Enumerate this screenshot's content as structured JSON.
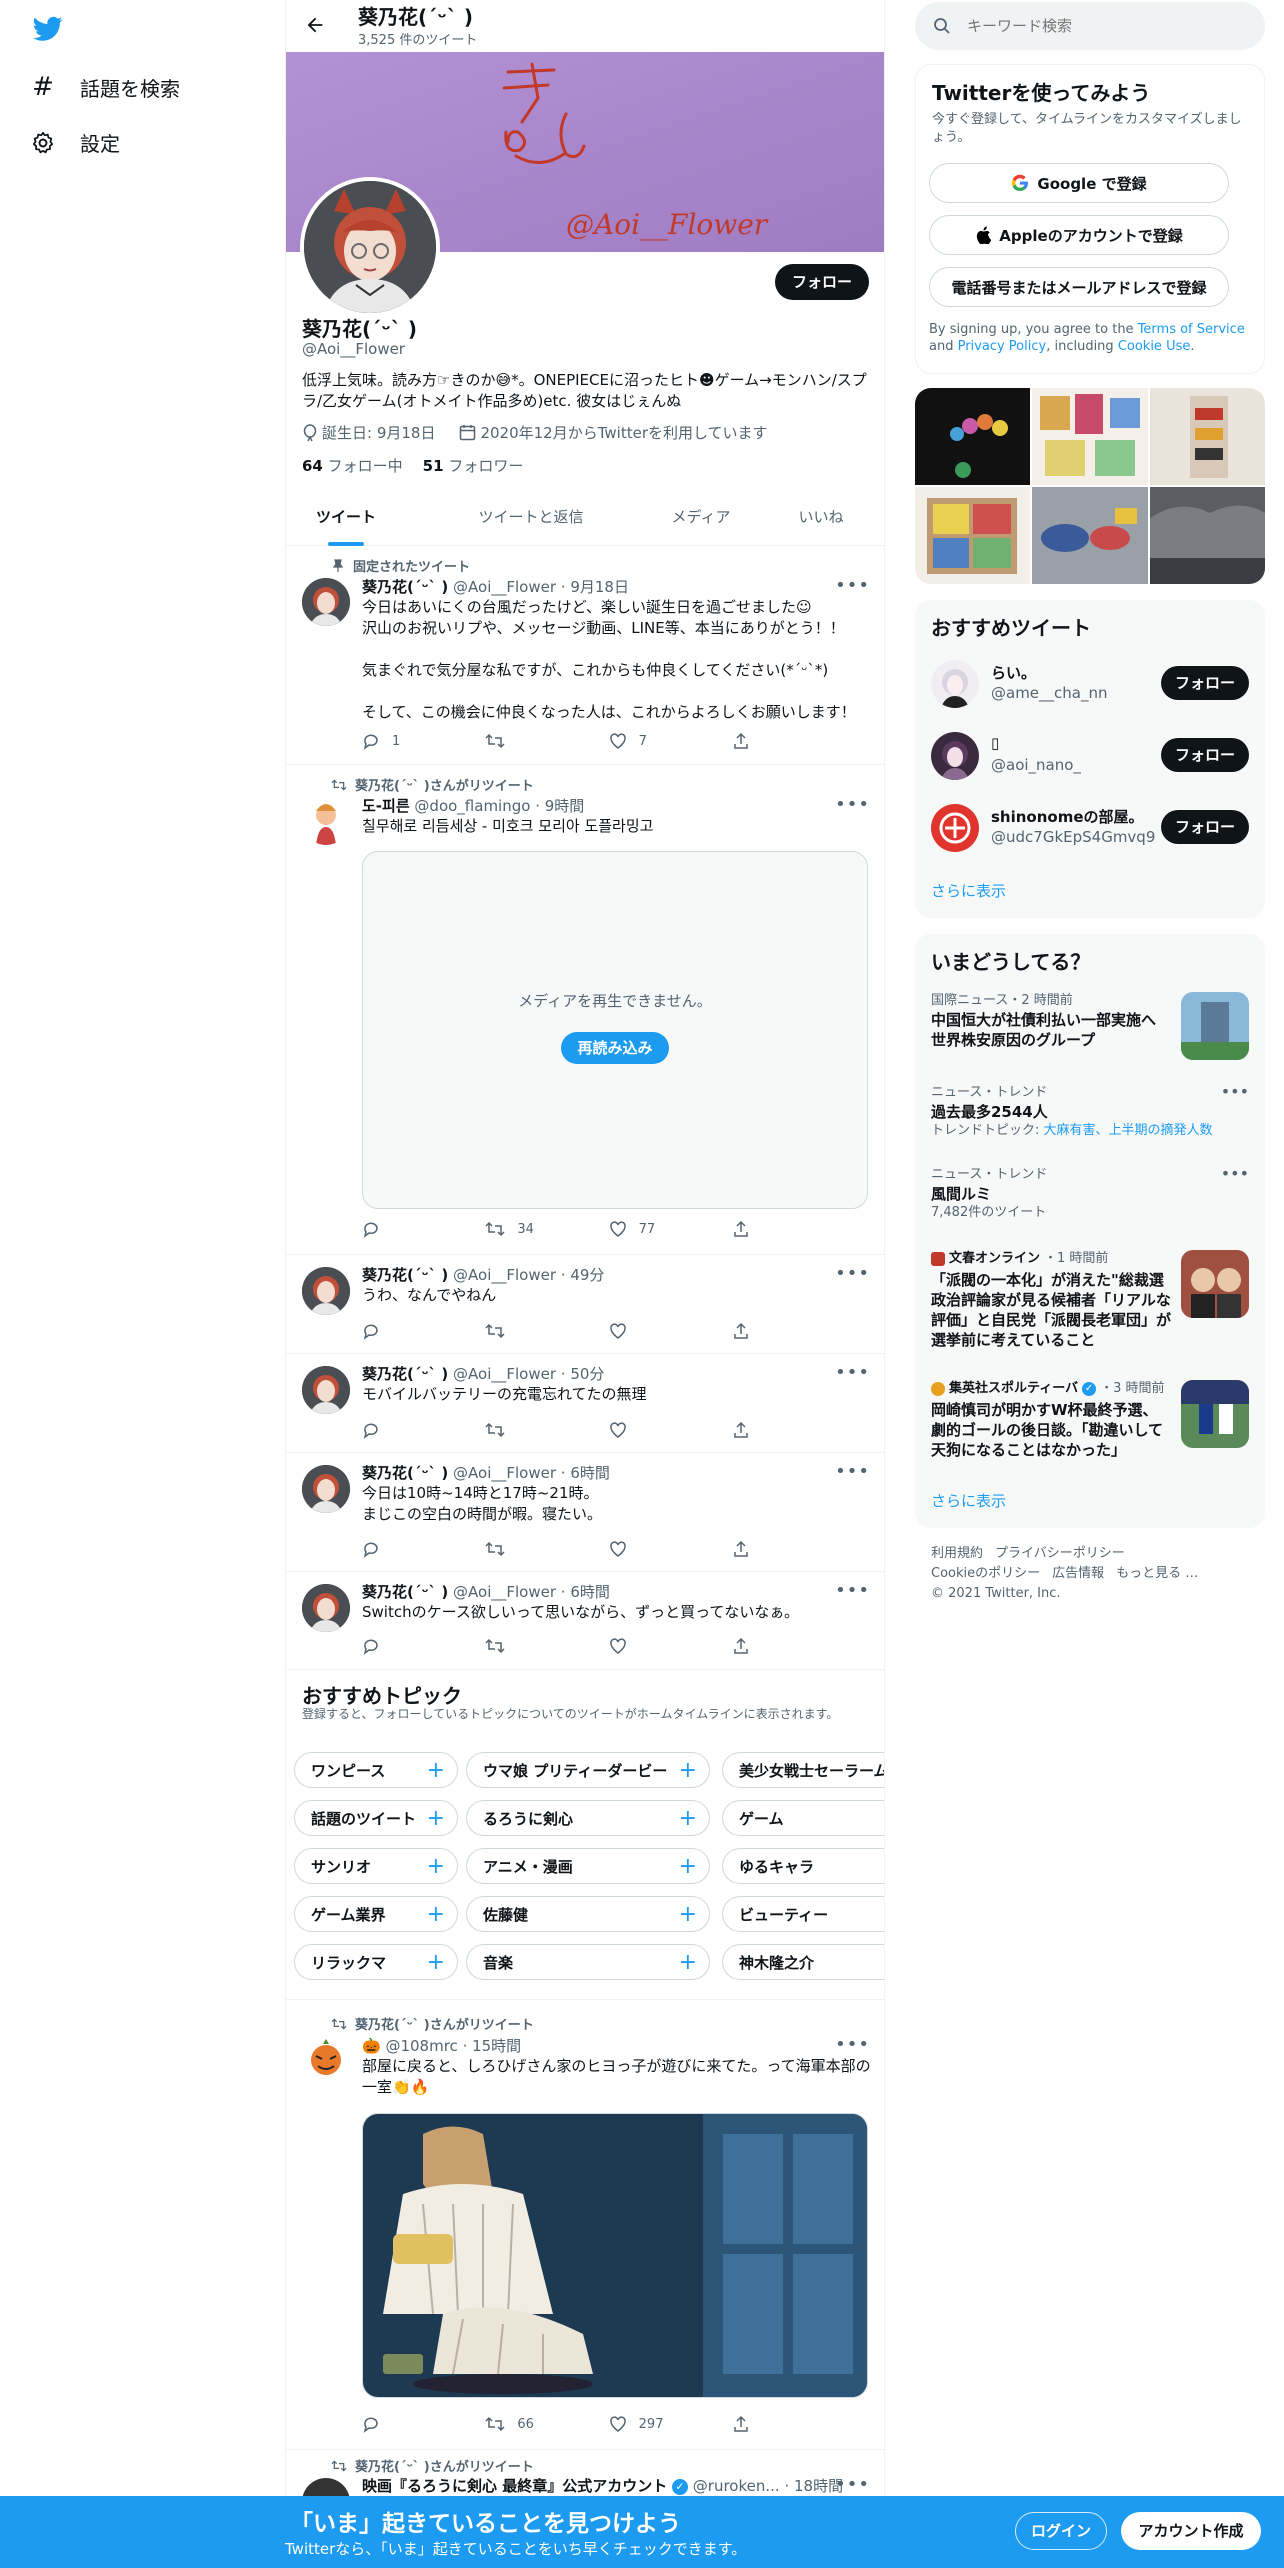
{
  "nav": {
    "explore_label": "話題を検索",
    "settings_label": "設定"
  },
  "header": {
    "name": "葵乃花(ˊᵕˋ )",
    "tweet_count": "3,525 件のツイート"
  },
  "banner": {
    "handwriting_top": "きか",
    "handwriting_handle": "@Aoi__Flower"
  },
  "profile": {
    "follow_label": "フォロー",
    "name": "葵乃花(ˊᵕˋ )",
    "handle": "@Aoi__Flower",
    "bio": "低浮上気味。読み方☞きのか😅*。ONEPIECEに沼ったヒト☻ゲーム→モンハン/スプラ/乙女ゲーム(オトメイト作品多め)etc. 彼女はじぇんぬ",
    "birthday": "誕生日: 9月18日",
    "joined": "2020年12月からTwitterを利用しています",
    "following_count": "64",
    "following_label": "フォロー中",
    "followers_count": "51",
    "followers_label": "フォロワー"
  },
  "tabs": [
    {
      "label": "ツイート",
      "active": true
    },
    {
      "label": "ツイートと返信",
      "active": false
    },
    {
      "label": "メディア",
      "active": false
    },
    {
      "label": "いいね",
      "active": false
    }
  ],
  "tweets": {
    "t1": {
      "social": "固定されたツイート",
      "name": "葵乃花(ˊᵕˋ )",
      "meta": "@Aoi__Flower · 9月18日",
      "text": "今日はあいにくの台風だったけど、楽しい誕生日を過ごせました☺\n沢山のお祝いリプや、メッセージ動画、LINE等、本当にありがとう！！\n\n気まぐれで気分屋な私ですが、これからも仲良くしてください(*ˊᵕˋ*)\n\nそして、この機会に仲良くなった人は、これからよろしくお願いします！",
      "replies": "1",
      "retweets": "",
      "likes": "7"
    },
    "t2": {
      "social": "葵乃花(ˊᵕˋ )さんがリツイート",
      "name": "도-피른",
      "meta": "@doo_flamingo · 9時間",
      "text": "칠무해로 리듬세상 - 미호크 모리아 도플라밍고",
      "media_error": "メディアを再生できません。",
      "reload_label": "再読み込み",
      "replies": "",
      "retweets": "34",
      "likes": "77"
    },
    "t3": {
      "name": "葵乃花(ˊᵕˋ )",
      "meta": "@Aoi__Flower · 49分",
      "text": "うわ、なんでやねん"
    },
    "t4": {
      "name": "葵乃花(ˊᵕˋ )",
      "meta": "@Aoi__Flower · 50分",
      "text": "モバイルバッテリーの充電忘れてたの無理"
    },
    "t5": {
      "name": "葵乃花(ˊᵕˋ )",
      "meta": "@Aoi__Flower · 6時間",
      "text": "今日は10時~14時と17時~21時。\nまじこの空白の時間が暇。寝たい。"
    },
    "t6": {
      "name": "葵乃花(ˊᵕˋ )",
      "meta": "@Aoi__Flower · 6時間",
      "text": "Switchのケース欲しいって思いながら、ずっと買ってないなぁ。"
    },
    "t7": {
      "social": "葵乃花(ˊᵕˋ )さんがリツイート",
      "name": "🎃",
      "meta": "@108mrc · 15時間",
      "text": "部屋に戻ると、しろひげさん家のヒヨっ子が遊びに来てた。って海軍本部の一室👏🔥",
      "replies": "",
      "retweets": "66",
      "likes": "297"
    },
    "t8": {
      "social": "葵乃花(ˊᵕˋ )さんがリツイート",
      "name": "映画『るろうに剣心 最終章』公式アカウント",
      "meta": "@ruroken... · 18時間"
    }
  },
  "topics": {
    "title": "おすすめトピック",
    "subtitle": "登録すると、フォローしているトピックについてのツイートがホームタイムラインに表示されます。",
    "col1": [
      "ワンピース",
      "話題のツイート",
      "サンリオ",
      "ゲーム業界",
      "リラックマ"
    ],
    "col2": [
      "ウマ娘 プリティーダービー",
      "るろうに剣心",
      "アニメ・漫画",
      "佐藤健",
      "音楽"
    ],
    "col3": [
      "美少女戦士セーラームーン",
      "ゲーム",
      "ゆるキャラ",
      "ビューティー",
      "神木隆之介"
    ]
  },
  "search": {
    "placeholder": "キーワード検索"
  },
  "signup": {
    "title": "Twitterを使ってみよう",
    "subtitle": "今すぐ登録して、タイムラインをカスタマイズしましょう。",
    "google_label": "Google で登録",
    "apple_label": "Appleのアカウントで登録",
    "phone_label": "電話番号またはメールアドレスで登録",
    "legal_prefix": "By signing up, you agree to the ",
    "terms_link": "Terms of Service",
    "legal_and": " and ",
    "privacy_link": "Privacy Policy",
    "legal_including": ", including ",
    "cookie_link": "Cookie Use",
    "legal_end": "."
  },
  "recommended": {
    "title": "おすすめツイート",
    "follow_label": "フォロー",
    "users": [
      {
        "name": "らい。",
        "handle": "@ame__cha_nn"
      },
      {
        "name": "▯",
        "handle": "@aoi_nano_"
      },
      {
        "name": "shinonomeの部屋。",
        "handle": "@udc7GkEpS4Gmvq9"
      }
    ],
    "show_more": "さらに表示"
  },
  "trends": {
    "title": "いまどうしてる？",
    "items": [
      {
        "meta": "国際ニュース・2 時間前",
        "title": "中国恒大が社債利払い一部実施へ 世界株安原因のグループ"
      },
      {
        "meta": "ニュース・トレンド",
        "title": "過去最多2544人",
        "sub_prefix": "トレンドトピック: ",
        "sub_links": "大麻有害、上半期の摘発人数"
      },
      {
        "meta": "ニュース・トレンド",
        "title": "風間ルミ",
        "sub": "7,482件のツイート"
      },
      {
        "meta_source": "文春オンライン",
        "meta_time": "・1 時間前",
        "title": "「派閥の一本化」が消えた\"総裁選 政治評論家が見る候補者「リアルな評価」と自民党「派閥長老軍団」が選挙前に考えていること"
      },
      {
        "meta_source": "集英社スポルティーバ",
        "meta_time": "・3 時間前",
        "title": "岡崎慎司が明かすW杯最終予選、劇的ゴールの後日談。「勘違いして天狗になることはなかった」"
      }
    ],
    "show_more": "さらに表示"
  },
  "footer": {
    "links": [
      "利用規約",
      "プライバシーポリシー",
      "Cookieのポリシー",
      "広告情報",
      "もっと見る …"
    ],
    "copyright": "© 2021 Twitter, Inc."
  },
  "bottom": {
    "headline": "「いま」起きていることを見つけよう",
    "sub": "Twitterなら、「いま」起きていることをいち早くチェックできます。",
    "login_label": "ログイン",
    "signup_label": "アカウント作成"
  },
  "colors": {
    "accent": "#1d9bf0",
    "banner": "#ad88cc",
    "text": "#0f1419",
    "muted": "#536471"
  }
}
